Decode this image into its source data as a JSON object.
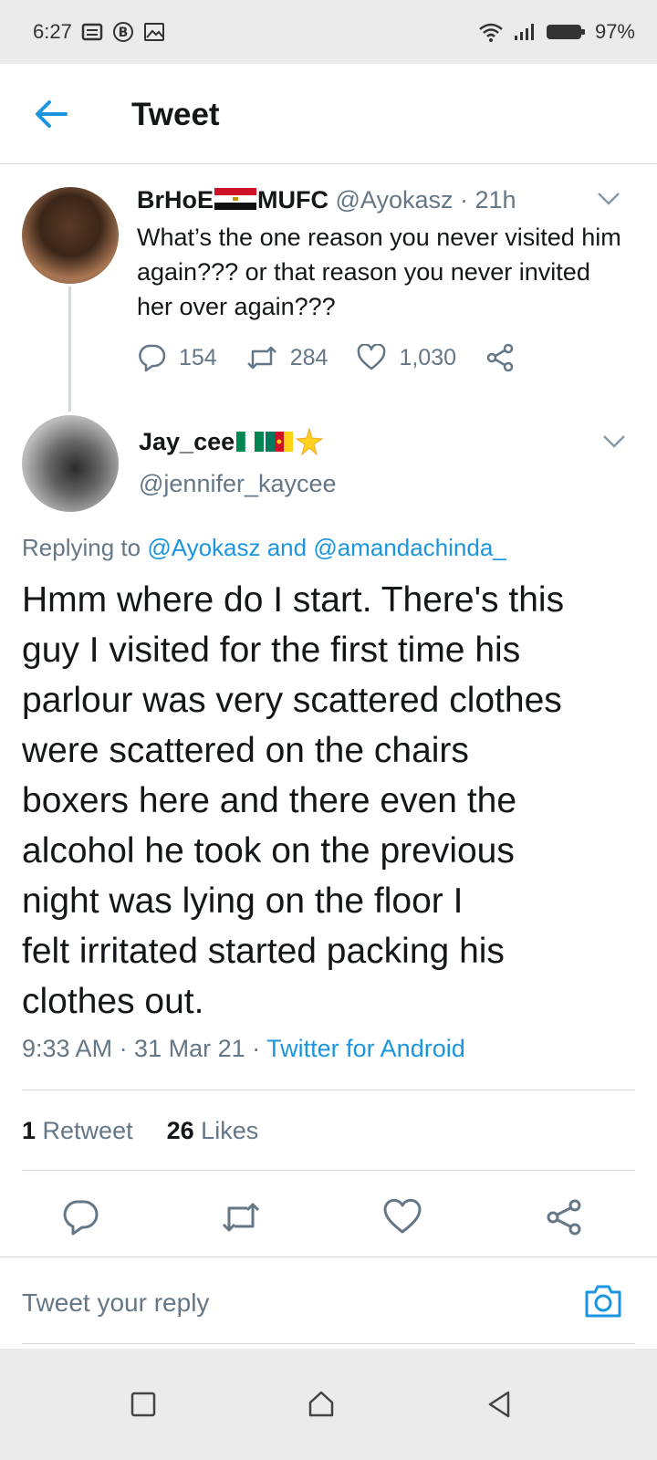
{
  "status_bar": {
    "time": "6:27",
    "battery": "97%",
    "icons": [
      "notes-icon",
      "b-circle-icon",
      "image-icon",
      "wifi-icon",
      "signal-icon",
      "battery-icon"
    ]
  },
  "header": {
    "title": "Tweet"
  },
  "parent_tweet": {
    "name_prefix": "BrHoE",
    "name_suffix": "MUFC",
    "handle_time": "@Ayokasz · 21h",
    "text": "What’s the one reason you never visited him again??? or that reason you never invited her over again???",
    "replies": "154",
    "retweets": "284",
    "likes": "1,030"
  },
  "main_tweet": {
    "name": "Jay_cee",
    "handle": "@jennifer_kaycee",
    "replying_prefix": "Replying to ",
    "replying_users": "@Ayokasz and @amandachinda_",
    "text_lines": [
      "Hmm where do I start. There's this",
      "guy I visited for the first time his",
      "parlour was very scattered clothes",
      "were scattered on the chairs",
      "boxers here and there even the",
      "alcohol he took on the previous",
      "night was lying on the floor I",
      "felt irritated started packing his",
      "clothes out."
    ],
    "timestamp": "9:33 AM · 31 Mar 21 · ",
    "source": "Twitter for Android",
    "retweet_count": "1",
    "retweet_label": " Retweet",
    "like_count": "26",
    "like_label": " Likes"
  },
  "reply_bar": {
    "placeholder": "Tweet your reply"
  },
  "colors": {
    "accent": "#1b95e0",
    "text": "#14171a",
    "muted": "#657786",
    "divider": "#d6d6d6",
    "system_bar": "#ebebeb"
  }
}
